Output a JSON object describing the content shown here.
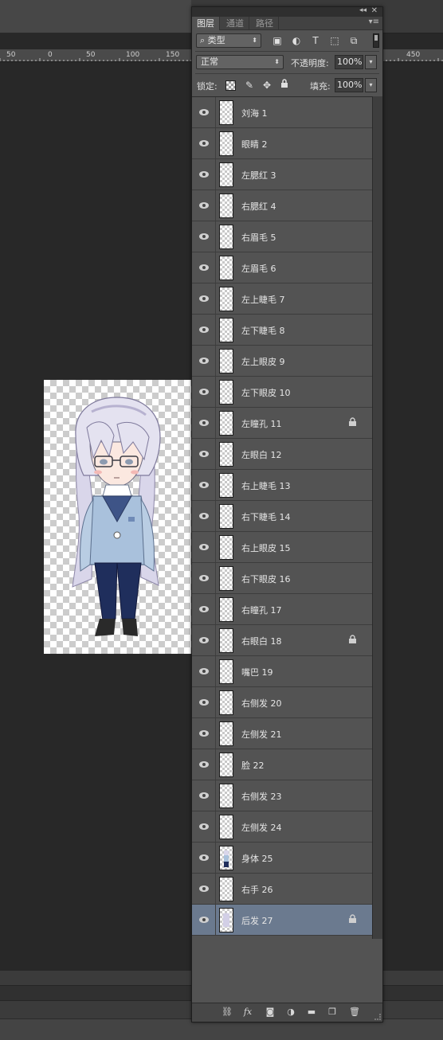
{
  "ruler": {
    "numbers": [
      "50",
      "0",
      "50",
      "100",
      "150",
      "450"
    ]
  },
  "panel": {
    "collapse_glyph": "◂◂",
    "close_glyph": "✕",
    "menu_glyph": "▾≡",
    "tabs": [
      {
        "label": "图层",
        "active": true
      },
      {
        "label": "通道",
        "active": false
      },
      {
        "label": "路径",
        "active": false
      }
    ],
    "filter": {
      "label": "类型",
      "icons": [
        "image-filter",
        "adjustment-filter",
        "type-filter",
        "shape-filter",
        "smart-object-filter"
      ]
    },
    "blend_mode": "正常",
    "opacity_label": "不透明度:",
    "opacity_value": "100%",
    "lock_label": "锁定:",
    "fill_label": "填充:",
    "fill_value": "100%",
    "bottom_icons": [
      "link-layers",
      "fx",
      "add-mask",
      "new-adjustment",
      "new-group",
      "new-layer",
      "delete"
    ]
  },
  "layers": [
    {
      "name": "刘海 1",
      "locked": false,
      "selected": false
    },
    {
      "name": "眼睛 2",
      "locked": false,
      "selected": false
    },
    {
      "name": "左腮红 3",
      "locked": false,
      "selected": false
    },
    {
      "name": "右腮红 4",
      "locked": false,
      "selected": false
    },
    {
      "name": "右眉毛 5",
      "locked": false,
      "selected": false
    },
    {
      "name": "左眉毛 6",
      "locked": false,
      "selected": false
    },
    {
      "name": "左上睫毛 7",
      "locked": false,
      "selected": false
    },
    {
      "name": "左下睫毛 8",
      "locked": false,
      "selected": false
    },
    {
      "name": "左上眼皮 9",
      "locked": false,
      "selected": false
    },
    {
      "name": "左下眼皮 10",
      "locked": false,
      "selected": false
    },
    {
      "name": "左瞳孔 11",
      "locked": true,
      "selected": false
    },
    {
      "name": "左眼白 12",
      "locked": false,
      "selected": false
    },
    {
      "name": "右上睫毛 13",
      "locked": false,
      "selected": false
    },
    {
      "name": "右下睫毛 14",
      "locked": false,
      "selected": false
    },
    {
      "name": "右上眼皮 15",
      "locked": false,
      "selected": false
    },
    {
      "name": "右下眼皮 16",
      "locked": false,
      "selected": false
    },
    {
      "name": "右瞳孔 17",
      "locked": false,
      "selected": false
    },
    {
      "name": "右眼白 18",
      "locked": true,
      "selected": false
    },
    {
      "name": "嘴巴 19",
      "locked": false,
      "selected": false
    },
    {
      "name": "右侧发 20",
      "locked": false,
      "selected": false
    },
    {
      "name": "左侧发 21",
      "locked": false,
      "selected": false
    },
    {
      "name": "脸 22",
      "locked": false,
      "selected": false
    },
    {
      "name": "右侧发 23",
      "locked": false,
      "selected": false
    },
    {
      "name": "左侧发 24",
      "locked": false,
      "selected": false
    },
    {
      "name": "身体 25",
      "locked": false,
      "selected": false,
      "thumb": "body"
    },
    {
      "name": "右手 26",
      "locked": false,
      "selected": false
    },
    {
      "name": "后发 27",
      "locked": true,
      "selected": true,
      "thumb": "hair"
    }
  ],
  "colors": {
    "workspace": "#282828",
    "panel": "#535353",
    "selected_layer": "#6b7a8f"
  }
}
